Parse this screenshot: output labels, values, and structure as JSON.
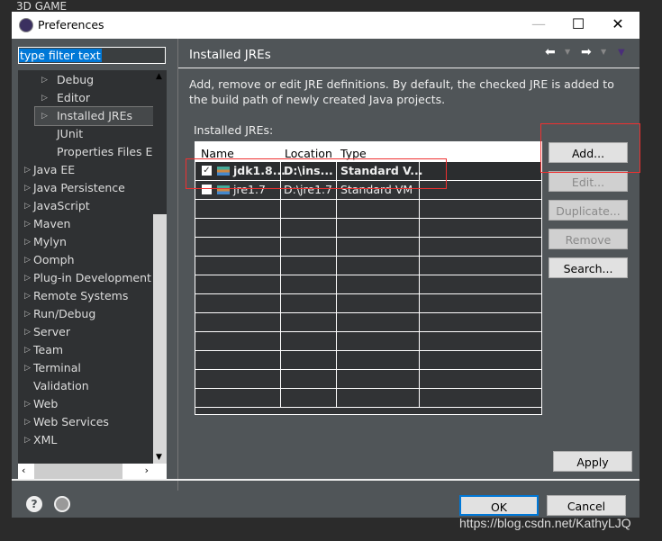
{
  "ide": {
    "title": "3D GAME",
    "watermark": "https://blog.csdn.net/KathyLJQ"
  },
  "dialog": {
    "title": "Preferences",
    "filter_placeholder": "type filter text"
  },
  "tree": [
    {
      "label": "Debug",
      "expand": true,
      "indent": 1
    },
    {
      "label": "Editor",
      "expand": true,
      "indent": 1
    },
    {
      "label": "Installed JREs",
      "expand": true,
      "indent": 1,
      "selected": true
    },
    {
      "label": "JUnit",
      "expand": false,
      "indent": 1
    },
    {
      "label": "Properties Files Editor",
      "expand": false,
      "indent": 1
    },
    {
      "label": "Java EE",
      "expand": true,
      "indent": 0
    },
    {
      "label": "Java Persistence",
      "expand": true,
      "indent": 0
    },
    {
      "label": "JavaScript",
      "expand": true,
      "indent": 0
    },
    {
      "label": "Maven",
      "expand": true,
      "indent": 0
    },
    {
      "label": "Mylyn",
      "expand": true,
      "indent": 0
    },
    {
      "label": "Oomph",
      "expand": true,
      "indent": 0
    },
    {
      "label": "Plug-in Development",
      "expand": true,
      "indent": 0
    },
    {
      "label": "Remote Systems",
      "expand": true,
      "indent": 0
    },
    {
      "label": "Run/Debug",
      "expand": true,
      "indent": 0
    },
    {
      "label": "Server",
      "expand": true,
      "indent": 0
    },
    {
      "label": "Team",
      "expand": true,
      "indent": 0
    },
    {
      "label": "Terminal",
      "expand": true,
      "indent": 0
    },
    {
      "label": "Validation",
      "expand": false,
      "indent": 0
    },
    {
      "label": "Web",
      "expand": true,
      "indent": 0
    },
    {
      "label": "Web Services",
      "expand": true,
      "indent": 0
    },
    {
      "label": "XML",
      "expand": true,
      "indent": 0
    }
  ],
  "page": {
    "title": "Installed JREs",
    "description": "Add, remove or edit JRE definitions. By default, the checked JRE is added to the build path of newly created Java projects.",
    "table_label": "Installed JREs:"
  },
  "table": {
    "columns": [
      "Name",
      "Location",
      "Type"
    ],
    "rows": [
      {
        "checked": true,
        "name": "jdk1.8...",
        "location": "D:\\ins...",
        "type": "Standard V...",
        "bold": true
      },
      {
        "checked": false,
        "name": "jre1.7",
        "location": "D:\\jre1.7",
        "type": "Standard VM",
        "bold": false
      }
    ]
  },
  "buttons": {
    "add": "Add...",
    "edit": "Edit...",
    "duplicate": "Duplicate...",
    "remove": "Remove",
    "search": "Search...",
    "apply": "Apply",
    "ok": "OK",
    "cancel": "Cancel"
  },
  "colors": {
    "highlight": "#f03030",
    "accent": "#0078d7"
  }
}
